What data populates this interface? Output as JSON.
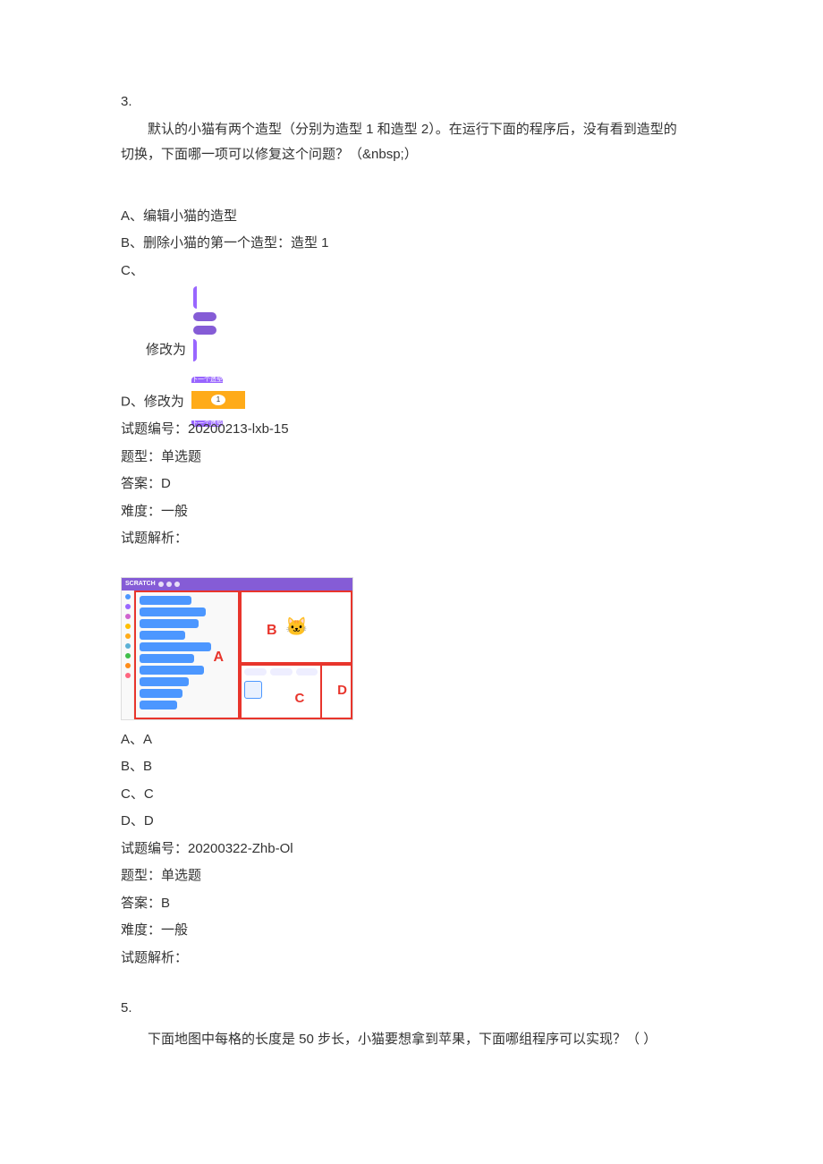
{
  "q3": {
    "number": "3.",
    "prompt_indent": "默认的小猫有两个造型（分别为造型 1 和造型 2）。在运行下面的程序后，没有看到造型的",
    "prompt_cont": "切换，下面哪一项可以修复这个问题？（&nbsp;）",
    "optA": "A、编辑小猫的造型",
    "optB": "B、删除小猫的第一个造型：造型 1",
    "optC_prefix": "C、",
    "optC_label": "修改为",
    "optD": "D、修改为",
    "block_d_top": "下一个造型",
    "block_d_mid": "1",
    "block_d_bot": "下一个造型",
    "meta_id": "试题编号：20200213-lxb-15",
    "meta_type": "题型：单选题",
    "meta_ans": "答案：D",
    "meta_diff": "难度：一般",
    "meta_expl": "试题解析："
  },
  "q4": {
    "ui_logo": "SCRATCH",
    "optA": "A、A",
    "optB": "B、B",
    "optC": "C、C",
    "optD": "D、D",
    "labelA": "A",
    "labelB": "B",
    "labelC": "C",
    "labelD": "D",
    "meta_id": "试题编号：20200322-Zhb-Ol",
    "meta_type": "题型：单选题",
    "meta_ans": "答案：B",
    "meta_diff": "难度：一般",
    "meta_expl": "试题解析："
  },
  "q5": {
    "number": "5.",
    "prompt": "下面地图中每格的长度是 50 步长，小猫要想拿到苹果，下面哪组程序可以实现？（ ）"
  }
}
